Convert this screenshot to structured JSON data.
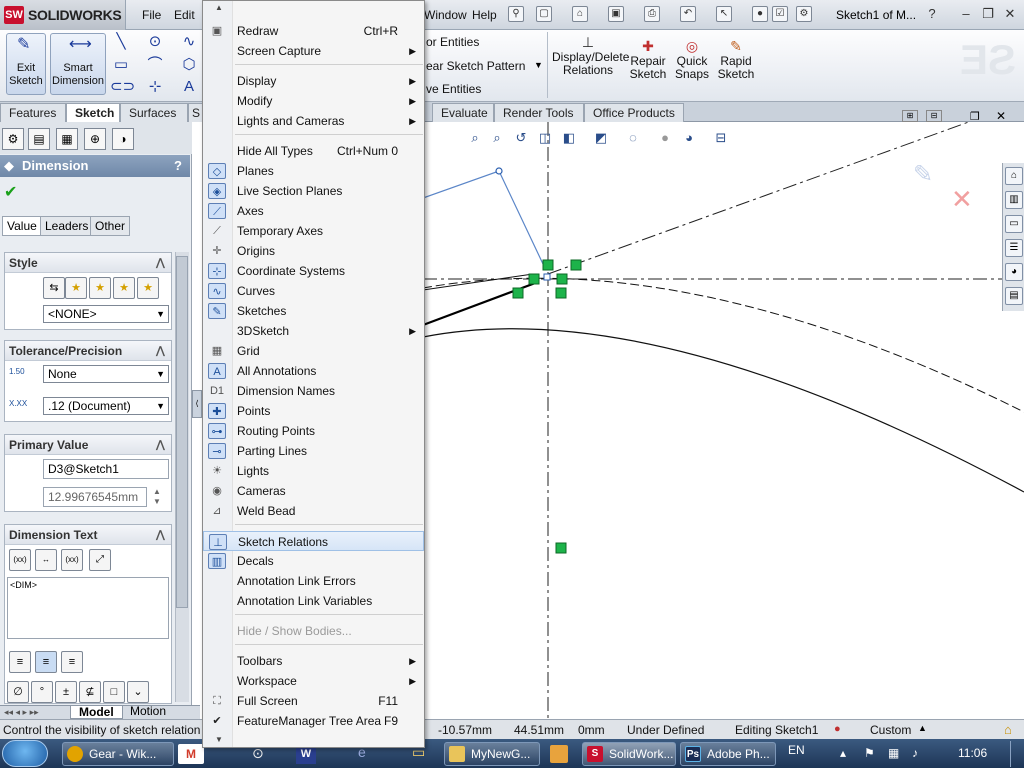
{
  "titlebar": {
    "app_name": "SOLIDWORKS",
    "logo_mark": "SW",
    "menus": [
      "File",
      "Edit",
      "Window",
      "Help"
    ],
    "doc_title": "Sketch1 of M..."
  },
  "command_manager": {
    "exit_sketch_line1": "Exit",
    "exit_sketch_line2": "Sketch",
    "smart_dim_line1": "Smart",
    "smart_dim_line2": "Dimension",
    "offset_entities": "or Entities",
    "linear_pattern": "ear Sketch Pattern",
    "move_entities": "ve Entities",
    "display_relations_line1": "Display/Delete",
    "display_relations_line2": "Relations",
    "repair_line1": "Repair",
    "repair_line2": "Sketch",
    "quick_snaps_line1": "Quick",
    "quick_snaps_line2": "Snaps",
    "rapid_line1": "Rapid",
    "rapid_line2": "Sketch"
  },
  "tabs": [
    "Features",
    "Sketch",
    "Surfaces",
    "S",
    "Evaluate",
    "Render Tools",
    "Office Products"
  ],
  "property_manager": {
    "title": "Dimension",
    "help": "?",
    "subtabs": [
      "Value",
      "Leaders",
      "Other"
    ],
    "style_group": "Style",
    "style_value": "<NONE>",
    "tolerance_group": "Tolerance/Precision",
    "tol_icon_label": "1.50",
    "tolerance_value": "None",
    "precision_icon_label": "X.XX",
    "precision_value": ".12 (Document)",
    "primary_group": "Primary Value",
    "primary_name": "D3@Sketch1",
    "primary_value": "12.99676545mm",
    "dimtext_group": "Dimension Text",
    "dimtext_value": "<DIM>"
  },
  "bottom_tabs": [
    "Model",
    "Motion Study"
  ],
  "status": {
    "message": "Control the visibility of sketch relation",
    "x": "-10.57mm",
    "y": "44.51mm",
    "z": "0mm",
    "state": "Under Defined",
    "editing": "Editing Sketch1",
    "units": "Custom"
  },
  "taskbar": {
    "items": [
      "Gear - Wik...",
      "MyNewG...",
      "SolidWork...",
      "Adobe Ph..."
    ],
    "lang": "EN",
    "time": "11:06"
  },
  "context_menu": {
    "items": [
      {
        "label": "Redraw",
        "shortcut": "Ctrl+R",
        "icon": "redraw-icon"
      },
      {
        "label": "Screen Capture",
        "submenu": true
      },
      {
        "label": "Display",
        "submenu": true
      },
      {
        "label": "Modify",
        "submenu": true
      },
      {
        "label": "Lights and Cameras",
        "submenu": true
      },
      {
        "label": "Hide All Types",
        "shortcut": "Ctrl+Num 0"
      },
      {
        "label": "Planes",
        "icon": "planes-icon",
        "on": true
      },
      {
        "label": "Live Section Planes",
        "icon": "live-section-icon",
        "on": true
      },
      {
        "label": "Axes",
        "icon": "axes-icon",
        "on": true
      },
      {
        "label": "Temporary Axes",
        "icon": "temp-axes-icon"
      },
      {
        "label": "Origins",
        "icon": "origins-icon"
      },
      {
        "label": "Coordinate Systems",
        "icon": "coord-icon",
        "on": true
      },
      {
        "label": "Curves",
        "icon": "curves-icon",
        "on": true
      },
      {
        "label": "Sketches",
        "icon": "sketches-icon",
        "on": true
      },
      {
        "label": "3DSketch",
        "submenu": true
      },
      {
        "label": "Grid",
        "icon": "grid-icon"
      },
      {
        "label": "All Annotations",
        "icon": "annotations-icon",
        "on": true
      },
      {
        "label": "Dimension Names",
        "icon": "dimnames-icon"
      },
      {
        "label": "Points",
        "icon": "points-icon",
        "on": true
      },
      {
        "label": "Routing Points",
        "icon": "routing-icon",
        "on": true
      },
      {
        "label": "Parting Lines",
        "icon": "parting-icon",
        "on": true
      },
      {
        "label": "Lights",
        "icon": "lights-icon"
      },
      {
        "label": "Cameras",
        "icon": "cameras-icon"
      },
      {
        "label": "Weld Bead",
        "icon": "weld-icon"
      },
      {
        "label": "Sketch Relations",
        "icon": "relations-icon",
        "on": true,
        "highlight": true
      },
      {
        "label": "Decals",
        "icon": "decals-icon",
        "on": true
      },
      {
        "label": "Annotation Link Errors"
      },
      {
        "label": "Annotation Link Variables"
      },
      {
        "label": "Hide / Show Bodies...",
        "disabled": true
      },
      {
        "label": "Toolbars",
        "submenu": true
      },
      {
        "label": "Workspace",
        "submenu": true
      },
      {
        "label": "Full Screen",
        "shortcut": "F11",
        "icon": "fullscreen-icon"
      },
      {
        "label": "FeatureManager Tree Area",
        "shortcut": "F9",
        "icon": "check-icon"
      }
    ]
  },
  "colors": {
    "accent": "#1c4f9a",
    "sketch_green": "#1db34a",
    "header_blue": "#7890ae"
  }
}
